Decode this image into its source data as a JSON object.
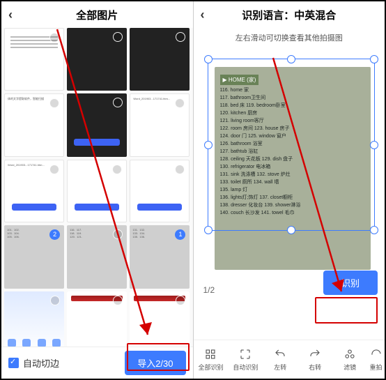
{
  "left": {
    "title": "全部图片",
    "autocrop": "自动切边",
    "import": "导入2/30",
    "sel_badge1": "2",
    "sel_badge2": "1",
    "thumb_text_small": "体的文字提取软件，智能扫描",
    "thumb_file_a": "Word_201903...171741.htm..."
  },
  "right": {
    "title": "识别语言：中英混合",
    "hint": "左右滑动可切换查看其他拍摄图",
    "page": "1/2",
    "recognize": "识别",
    "tools": [
      "全部识别",
      "自动识别",
      "左转",
      "右转",
      "滤镜",
      "重拍"
    ],
    "doc_title": "▶ HOME (家)",
    "doc_lines": [
      "116. home 家",
      "117. bathroom卫生间",
      "118. bed 床        119. bedroom卧室",
      "120. kitchen 厨房",
      "121. living room客厅",
      "122. room 房间       123. house 房子",
      "124. door 门         125. window 窗户",
      "126. bathroom 浴室",
      "127. bathtub 浴缸",
      "128. ceiling 天花板  129. dish 盘子",
      "130. refrigerator 电冰箱",
      "131. sink 洗涤槽    132. stove 炉灶",
      "133. toilet 厕所    134. wall 墙",
      "135. lamp 灯",
      "136. lights灯;饰灯   137. closet橱柜",
      "138. dresser 化妆台 139. shower淋浴",
      "140. couch 长沙发   141. towel 毛巾"
    ]
  },
  "colors": {
    "accent": "#3D7BFE",
    "annot": "#d40000"
  }
}
